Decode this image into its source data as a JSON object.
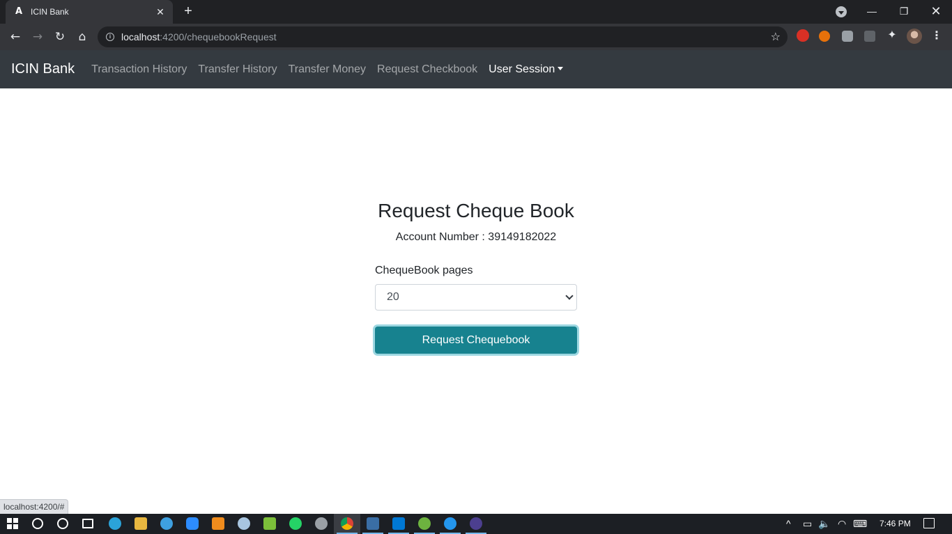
{
  "browser": {
    "tab_title": "ICIN Bank",
    "tab_favicon": "A",
    "close_tab_glyph": "✕",
    "new_tab_glyph": "+",
    "url_host": "localhost",
    "url_path": ":4200/chequebookRequest",
    "window_controls": {
      "minimize": "—",
      "restore": "❐",
      "close": "✕"
    },
    "nav_glyphs": {
      "back": "←",
      "forward": "→",
      "reload": "↻",
      "home": "⌂",
      "star": "☆",
      "menu": "⋮",
      "extensions": "✦"
    }
  },
  "navbar": {
    "brand": "ICIN Bank",
    "links": [
      "Transaction History",
      "Transfer History",
      "Transfer Money",
      "Request Checkbook",
      "User Session"
    ]
  },
  "main": {
    "heading": "Request Cheque Book",
    "account_label": "Account Number : 39149182022",
    "field_label": "ChequeBook pages",
    "select_value": "20",
    "submit_label": "Request Chequebook"
  },
  "status_bar": {
    "url": "localhost:4200/#"
  },
  "taskbar": {
    "clock": "7:46 PM",
    "tray_glyphs": {
      "chevron": "^",
      "battery": "▭",
      "volume": "🔈",
      "wifi": "◠",
      "keyboard": "⌨"
    }
  },
  "colors": {
    "navbar_bg": "#343a40",
    "button_bg": "#17828f",
    "chrome_toolbar": "#35363a",
    "chrome_tabstrip": "#202124"
  }
}
